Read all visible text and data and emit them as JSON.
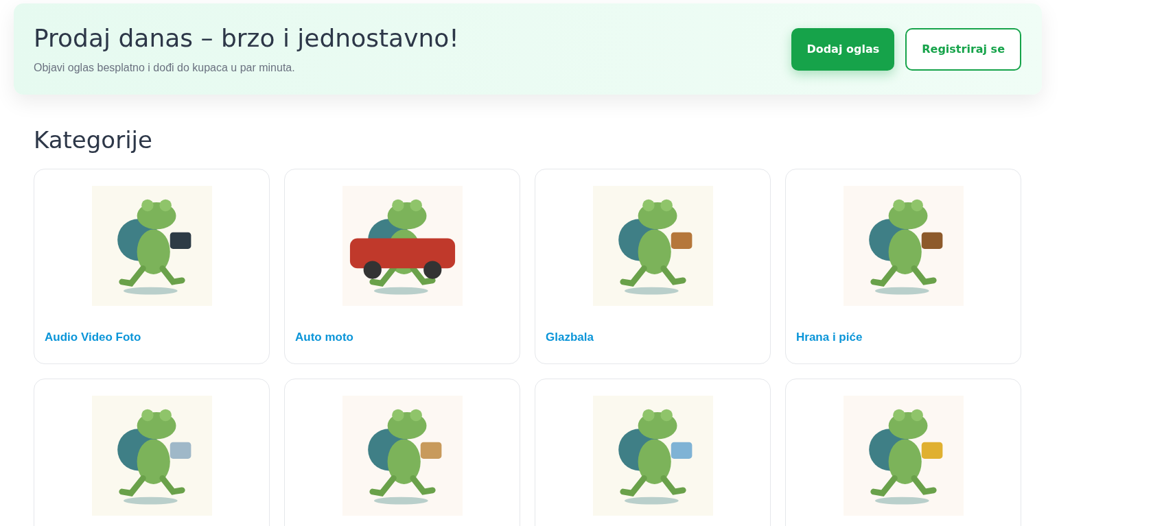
{
  "hero": {
    "title": "Prodaj danas – brzo i jednostavno!",
    "subtitle": "Objavi oglas besplatno i dođi do kupaca u par minuta.",
    "buttons": [
      {
        "label": "Dodaj oglas",
        "kind": "primary"
      },
      {
        "label": "Registriraj se",
        "kind": "outline"
      }
    ]
  },
  "section_title": "Kategorije",
  "categories": [
    {
      "label": "Audio Video Foto",
      "kind": "picture"
    },
    {
      "label": "Auto moto",
      "kind": "picture"
    },
    {
      "label": "Glazbala",
      "kind": "picture"
    },
    {
      "label": "Hrana i piće",
      "kind": "picture"
    },
    {
      "kind": "picture"
    },
    {
      "kind": "picture"
    },
    {
      "kind": "picture"
    },
    {
      "kind": "picture"
    }
  ]
}
